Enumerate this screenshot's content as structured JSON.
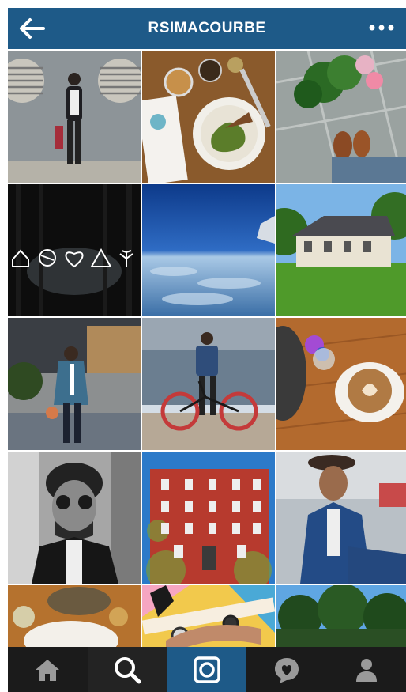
{
  "header": {
    "title": "RSIMACOURBE",
    "back_icon": "back-arrow-icon",
    "more_icon": "more-dots-icon",
    "bar_color": "#1e5a88"
  },
  "grid": {
    "columns": 3,
    "tiles": [
      {
        "subject": "man-by-wall-vents"
      },
      {
        "subject": "restaurant-plate-with-menu"
      },
      {
        "subject": "flowers-and-shoes"
      },
      {
        "subject": "dark-forest-with-symbols"
      },
      {
        "subject": "view-from-airplane"
      },
      {
        "subject": "house-and-lawn"
      },
      {
        "subject": "man-on-street-with-flowers"
      },
      {
        "subject": "man-with-bicycle-by-water"
      },
      {
        "subject": "coffee-and-flowers"
      },
      {
        "subject": "man-with-sunglasses-bw"
      },
      {
        "subject": "ivy-covered-building"
      },
      {
        "subject": "man-in-blue-suit"
      },
      {
        "subject": "table-with-food"
      },
      {
        "subject": "hands-with-watches"
      },
      {
        "subject": "trees-and-sky"
      }
    ]
  },
  "tabbar": {
    "items": [
      {
        "name": "home",
        "icon": "home-icon"
      },
      {
        "name": "search",
        "icon": "search-icon"
      },
      {
        "name": "camera",
        "icon": "camera-icon"
      },
      {
        "name": "activity",
        "icon": "heart-bubble-icon"
      },
      {
        "name": "profile",
        "icon": "profile-icon"
      }
    ],
    "camera_color": "#1e5a88"
  }
}
